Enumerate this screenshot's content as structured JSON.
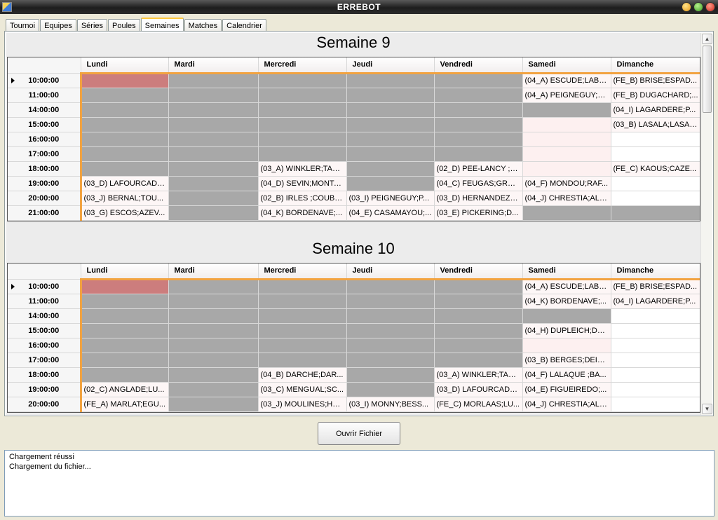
{
  "window": {
    "title": "ERREBOT"
  },
  "tabs": [
    "Tournoi",
    "Equipes",
    "Séries",
    "Poules",
    "Semaines",
    "Matches",
    "Calendrier"
  ],
  "active_tab": "Semaines",
  "columns": [
    "Lundi",
    "Mardi",
    "Mercredi",
    "Jeudi",
    "Vendredi",
    "Samedi",
    "Dimanche"
  ],
  "weeks": [
    {
      "title": "Semaine 9",
      "rows": [
        {
          "time": "10:00:00",
          "cells": [
            "",
            "",
            "",
            "",
            "",
            "(04_A) ESCUDE;LABE...",
            "(FE_B) BRISE;ESPAD..."
          ]
        },
        {
          "time": "11:00:00",
          "cells": [
            "",
            "",
            "",
            "",
            "",
            "(04_A) PEIGNEGUY;A...",
            "(FE_B) DUGACHARD;..."
          ]
        },
        {
          "time": "14:00:00",
          "cells": [
            "",
            "",
            "",
            "",
            "",
            "",
            "(04_I) LAGARDERE;P..."
          ]
        },
        {
          "time": "15:00:00",
          "cells": [
            "",
            "",
            "",
            "",
            "",
            "",
            "(03_B) LASALA;LASAL..."
          ]
        },
        {
          "time": "16:00:00",
          "cells": [
            "",
            "",
            "",
            "",
            "",
            "",
            ""
          ]
        },
        {
          "time": "17:00:00",
          "cells": [
            "",
            "",
            "",
            "",
            "",
            "",
            ""
          ]
        },
        {
          "time": "18:00:00",
          "cells": [
            "",
            "",
            "(03_A) WINKLER;TAU...",
            "",
            "(02_D) PEE-LANCY ;C...",
            "",
            "(FE_C) KAOUS;CAZE..."
          ]
        },
        {
          "time": "19:00:00",
          "cells": [
            "(03_D) LAFOURCADE...",
            "",
            "(04_D) SEVIN;MONTA...",
            "",
            "(04_C) FEUGAS;GRO...",
            "(04_F) MONDOU;RAF...",
            ""
          ]
        },
        {
          "time": "20:00:00",
          "cells": [
            "(03_J) BERNAL;TOU...",
            "",
            "(02_B) IRLES ;COUBL...",
            "(03_I) PEIGNEGUY;P...",
            "(03_D) HERNANDEZ ;...",
            "(04_J) CHRESTIA;ALC...",
            ""
          ]
        },
        {
          "time": "21:00:00",
          "cells": [
            "(03_G) ESCOS;AZEV...",
            "",
            "(04_K) BORDENAVE;...",
            "(04_E) CASAMAYOU;...",
            "(03_E) PICKERING;D...",
            "",
            ""
          ]
        }
      ]
    },
    {
      "title": "Semaine 10",
      "rows": [
        {
          "time": "10:00:00",
          "cells": [
            "",
            "",
            "",
            "",
            "",
            "(04_A) ESCUDE;LABE...",
            "(FE_B) BRISE;ESPAD..."
          ]
        },
        {
          "time": "11:00:00",
          "cells": [
            "",
            "",
            "",
            "",
            "",
            "(04_K) BORDENAVE;...",
            "(04_I) LAGARDERE;P..."
          ]
        },
        {
          "time": "14:00:00",
          "cells": [
            "",
            "",
            "",
            "",
            "",
            "",
            ""
          ]
        },
        {
          "time": "15:00:00",
          "cells": [
            "",
            "",
            "",
            "",
            "",
            "(04_H) DUPLEICH;DU...",
            ""
          ]
        },
        {
          "time": "16:00:00",
          "cells": [
            "",
            "",
            "",
            "",
            "",
            "",
            ""
          ]
        },
        {
          "time": "17:00:00",
          "cells": [
            "",
            "",
            "",
            "",
            "",
            "(03_B) BERGES;DEITI...",
            ""
          ]
        },
        {
          "time": "18:00:00",
          "cells": [
            "",
            "",
            "(04_B) DARCHE;DAR...",
            "",
            "(03_A) WINKLER;TAU...",
            "(04_F) LALAQUE ;BA...",
            ""
          ]
        },
        {
          "time": "19:00:00",
          "cells": [
            "(02_C) ANGLADE;LU...",
            "",
            "(03_C) MENGUAL;SC...",
            "",
            "(03_D) LAFOURCADE...",
            "(04_E) FIGUEIREDO;...",
            ""
          ]
        },
        {
          "time": "20:00:00",
          "cells": [
            "(FE_A) MARLAT;EGU...",
            "",
            "(03_J) MOULINES;HA...",
            "(03_I) MONNY;BESS...",
            "(FE_C) MORLAAS;LU...",
            "(04_J) CHRESTIA;ALC...",
            ""
          ]
        }
      ]
    }
  ],
  "open_button_label": "Ouvrir Fichier",
  "log": [
    "Chargement réussi",
    "Chargement du fichier..."
  ]
}
